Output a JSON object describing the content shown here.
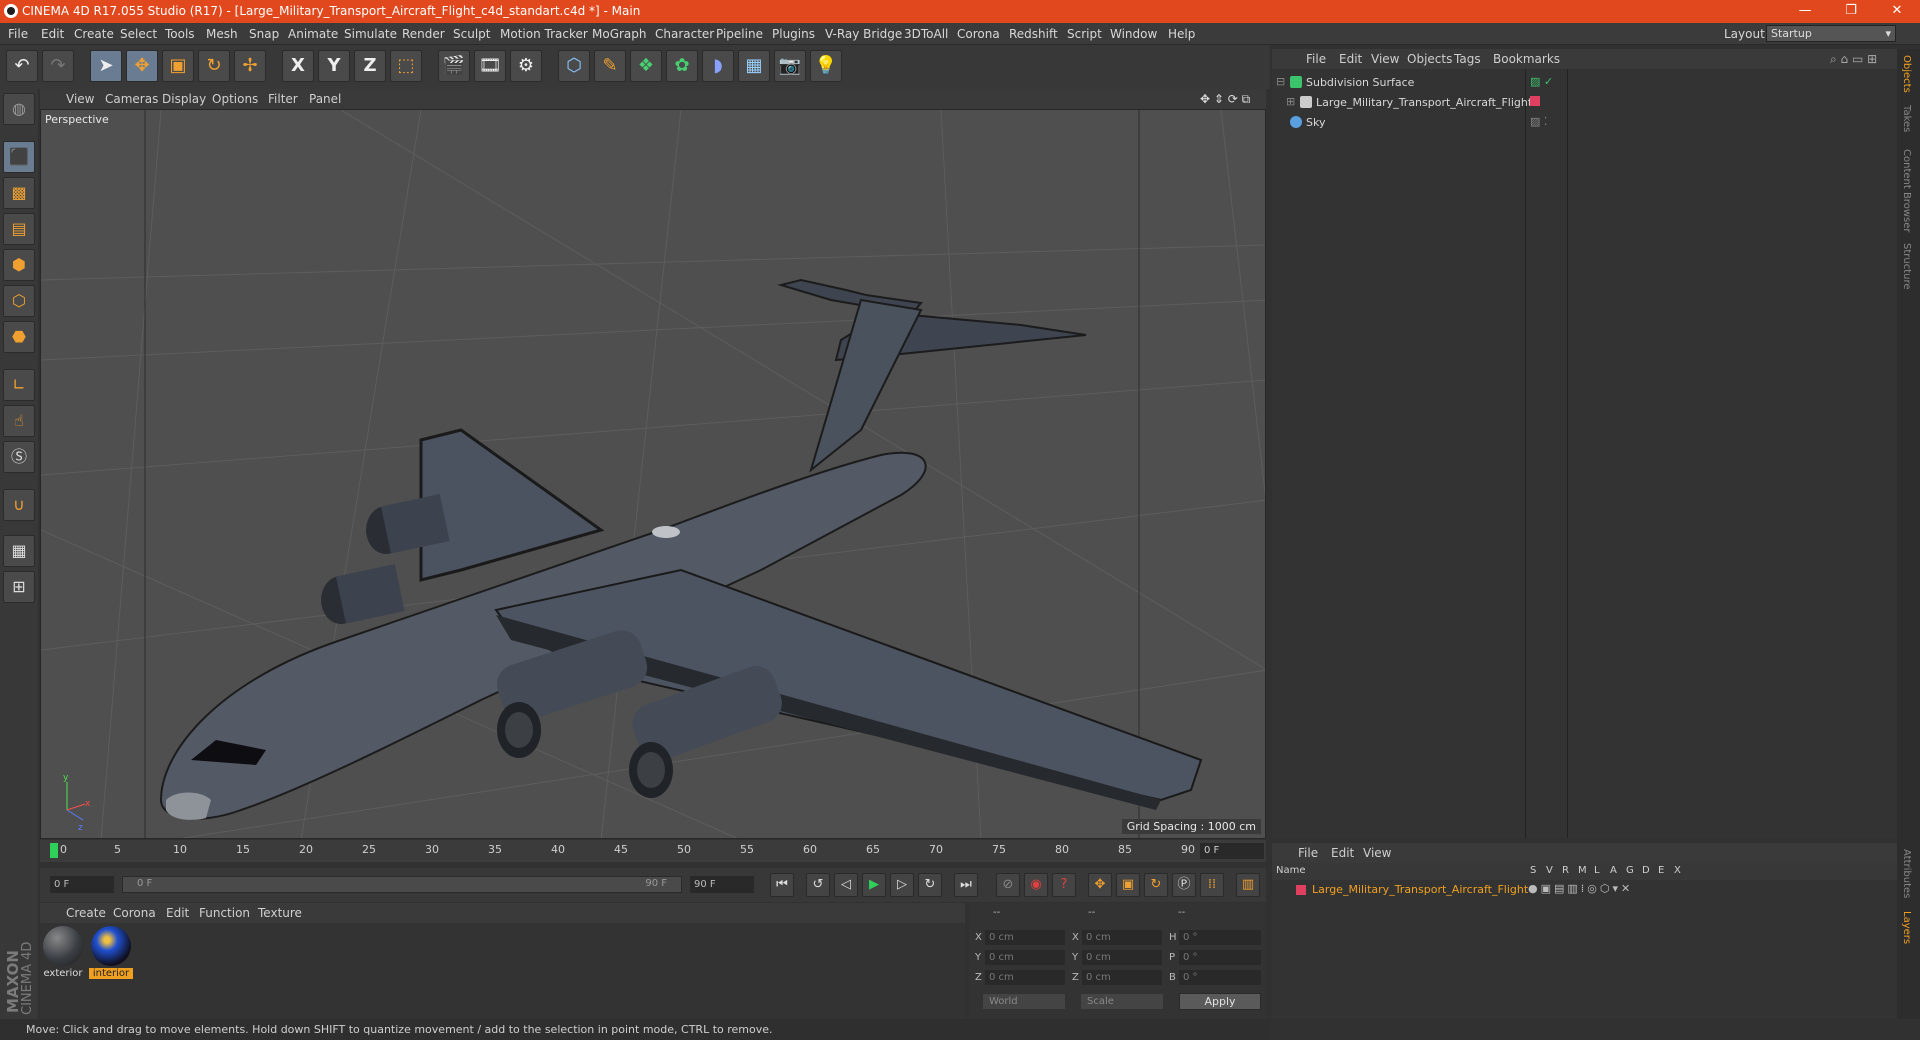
{
  "window": {
    "title": "CINEMA 4D R17.055 Studio (R17) - [Large_Military_Transport_Aircraft_Flight_c4d_standart.c4d *] - Main",
    "controls": [
      "—",
      "❐",
      "✕"
    ]
  },
  "menu": [
    "File",
    "Edit",
    "Create",
    "Select",
    "Tools",
    "Mesh",
    "Snap",
    "Animate",
    "Simulate",
    "Render",
    "Sculpt",
    "Motion Tracker",
    "MoGraph",
    "Character",
    "Pipeline",
    "Plugins",
    "V-Ray Bridge",
    "3DToAll",
    "Corona",
    "Redshift",
    "Script",
    "Window",
    "Help"
  ],
  "layout": {
    "label": "Layout:",
    "value": "Startup"
  },
  "toolbar": {
    "axis_x": "X",
    "axis_y": "Y",
    "axis_z": "Z"
  },
  "viewport": {
    "menu": [
      "View",
      "Cameras",
      "Display",
      "Options",
      "Filter",
      "Panel"
    ],
    "camera_label": "Perspective",
    "grid_spacing": "Grid Spacing : 1000 cm"
  },
  "timeline": {
    "ticks": [
      "0",
      "5",
      "10",
      "15",
      "20",
      "25",
      "30",
      "35",
      "40",
      "45",
      "50",
      "55",
      "60",
      "65",
      "70",
      "75",
      "80",
      "85",
      "90"
    ],
    "current_frame": "0 F",
    "start_frame": "0 F",
    "range_start": "0 F",
    "range_end": "90 F",
    "end_frame": "90 F"
  },
  "materials": {
    "menu": [
      "Create",
      "Corona",
      "Edit",
      "Function",
      "Texture"
    ],
    "items": [
      {
        "name": "exterior",
        "selected": false
      },
      {
        "name": "interior",
        "selected": true
      }
    ]
  },
  "coordinates": {
    "header": [
      "--",
      "--",
      "--"
    ],
    "rows": [
      {
        "a": "X",
        "av": "0 cm",
        "b": "X",
        "bv": "0 cm",
        "c": "H",
        "cv": "0 °"
      },
      {
        "a": "Y",
        "av": "0 cm",
        "b": "Y",
        "bv": "0 cm",
        "c": "P",
        "cv": "0 °"
      },
      {
        "a": "Z",
        "av": "0 cm",
        "b": "Z",
        "bv": "0 cm",
        "c": "B",
        "cv": "0 °"
      }
    ],
    "mode1": "World",
    "mode2": "Scale",
    "apply": "Apply"
  },
  "status": "Move: Click and drag to move elements. Hold down SHIFT to quantize movement / add to the selection in point mode, CTRL to remove.",
  "object_manager": {
    "menu": [
      "File",
      "Edit",
      "View",
      "Objects",
      "Tags",
      "Bookmarks"
    ],
    "objects": [
      {
        "name": "Subdivision Surface",
        "color": "#3bc46c"
      },
      {
        "name": "Large_Military_Transport_Aircraft_Flight",
        "color": "#cccccc"
      },
      {
        "name": "Sky",
        "color": "#5aa0e0"
      }
    ]
  },
  "right_tabs": [
    "Objects",
    "Takes",
    "Content Browser",
    "Structure",
    "Attributes",
    "Layers"
  ],
  "layer_manager": {
    "menu": [
      "File",
      "Edit",
      "View"
    ],
    "columns": [
      "Name",
      "S",
      "V",
      "R",
      "M",
      "L",
      "A",
      "G",
      "D",
      "E",
      "X"
    ],
    "layer_name": "Large_Military_Transport_Aircraft_Flight",
    "layer_color": "#e04060"
  },
  "colors": {
    "accent": "#e2481d",
    "selection": "#f0a020"
  }
}
